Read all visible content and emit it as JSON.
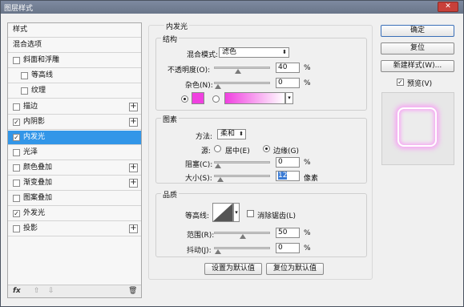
{
  "window": {
    "title": "图层样式",
    "close_label": "✕"
  },
  "sidebar": {
    "items": [
      {
        "label": "样式",
        "checkbox": false,
        "checked": false,
        "plus": false,
        "selected": false,
        "indent": 0
      },
      {
        "label": "混合选项",
        "checkbox": false,
        "checked": false,
        "plus": false,
        "selected": false,
        "indent": 0
      },
      {
        "label": "斜面和浮雕",
        "checkbox": true,
        "checked": false,
        "plus": false,
        "selected": false,
        "indent": 0
      },
      {
        "label": "等高线",
        "checkbox": true,
        "checked": false,
        "plus": false,
        "selected": false,
        "indent": 1
      },
      {
        "label": "纹理",
        "checkbox": true,
        "checked": false,
        "plus": false,
        "selected": false,
        "indent": 1
      },
      {
        "label": "描边",
        "checkbox": true,
        "checked": false,
        "plus": true,
        "selected": false,
        "indent": 0
      },
      {
        "label": "内阴影",
        "checkbox": true,
        "checked": true,
        "plus": true,
        "selected": false,
        "indent": 0
      },
      {
        "label": "内发光",
        "checkbox": true,
        "checked": true,
        "plus": false,
        "selected": true,
        "indent": 0
      },
      {
        "label": "光泽",
        "checkbox": true,
        "checked": false,
        "plus": false,
        "selected": false,
        "indent": 0
      },
      {
        "label": "颜色叠加",
        "checkbox": true,
        "checked": false,
        "plus": true,
        "selected": false,
        "indent": 0
      },
      {
        "label": "渐变叠加",
        "checkbox": true,
        "checked": false,
        "plus": true,
        "selected": false,
        "indent": 0
      },
      {
        "label": "图案叠加",
        "checkbox": true,
        "checked": false,
        "plus": false,
        "selected": false,
        "indent": 0
      },
      {
        "label": "外发光",
        "checkbox": true,
        "checked": true,
        "plus": false,
        "selected": false,
        "indent": 0
      },
      {
        "label": "投影",
        "checkbox": true,
        "checked": false,
        "plus": true,
        "selected": false,
        "indent": 0
      }
    ],
    "footer": {
      "fx": "fx",
      "up": "⇧",
      "down": "⇩",
      "trash": "🗑"
    }
  },
  "panel": {
    "title": "内发光",
    "structure": {
      "legend": "结构",
      "blend_mode_label": "混合模式:",
      "blend_mode_value": "滤色",
      "opacity_label": "不透明度(O):",
      "opacity_value": "40",
      "opacity_level": 0.4,
      "noise_label": "杂色(N):",
      "noise_value": "0",
      "noise_level": 0,
      "percent": "%",
      "glow_color": "#f040e0",
      "gradient_from": "#f040e0",
      "gradient_to": "#ffffff",
      "color_mode": "solid"
    },
    "elements": {
      "legend": "图素",
      "technique_label": "方法:",
      "technique_value": "柔和",
      "source_label": "源:",
      "source_center": "居中(E)",
      "source_edge": "边缘(G)",
      "source_selected": "edge",
      "choke_label": "阻塞(C):",
      "choke_value": "0",
      "choke_level": 0,
      "size_label": "大小(S):",
      "size_value": "12",
      "size_level": 0.05,
      "size_unit": "像素",
      "percent": "%"
    },
    "quality": {
      "legend": "品质",
      "contour_label": "等高线:",
      "antialias_label": "消除锯齿(L)",
      "antialias_checked": false,
      "range_label": "范围(R):",
      "range_value": "50",
      "range_level": 0.5,
      "jitter_label": "抖动(J):",
      "jitter_value": "0",
      "jitter_level": 0,
      "percent": "%"
    },
    "buttons": {
      "make_default": "设置为默认值",
      "reset_default": "复位为默认值"
    }
  },
  "right": {
    "ok": "确定",
    "reset": "复位",
    "new_style": "新建样式(W)...",
    "preview_label": "预览(V)",
    "preview_checked": true,
    "preview_glow": "#f6a8f3"
  }
}
